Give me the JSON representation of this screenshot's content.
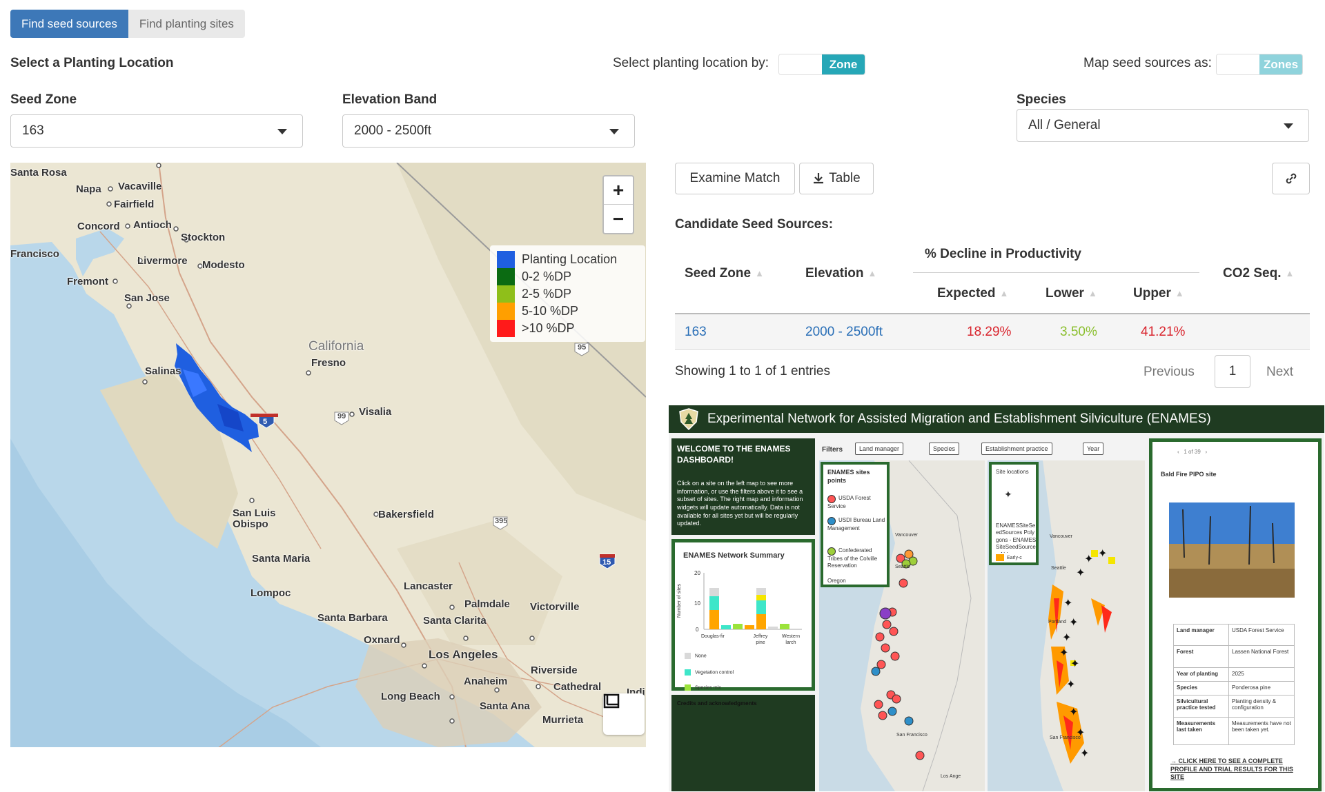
{
  "tabs": {
    "active": "Find seed sources",
    "inactive": "Find planting sites"
  },
  "header": {
    "select_title": "Select a Planting Location",
    "select_by_label": "Select planting location by:",
    "select_by_value": "Zone",
    "map_as_label": "Map seed sources as:",
    "map_as_value": "Zones"
  },
  "filters": {
    "seed_zone_label": "Seed Zone",
    "seed_zone_value": "163",
    "elevation_label": "Elevation Band",
    "elevation_value": "2000 - 2500ft",
    "species_label": "Species",
    "species_value": "All / General"
  },
  "map": {
    "zoom_in": "+",
    "zoom_out": "−",
    "labels": {
      "santa_rosa": "Santa Rosa",
      "napa": "Napa",
      "vacaville": "Vacaville",
      "fairfield": "Fairfield",
      "concord": "Concord",
      "antioch": "Antioch",
      "stockton": "Stockton",
      "san_francisco": "Francisco",
      "livermore": "Livermore",
      "modesto": "Modesto",
      "fremont": "Fremont",
      "san_jose": "San Jose",
      "california": "California",
      "fresno": "Fresno",
      "salinas": "Salinas",
      "visalia": "Visalia",
      "san_luis": "San Luis",
      "obispo": "Obispo",
      "bakersfield": "Bakersfield",
      "santa_maria": "Santa Maria",
      "lancaster": "Lancaster",
      "lompoc": "Lompoc",
      "palmdale": "Palmdale",
      "victorville": "Victorville",
      "santa_barbara": "Santa Barbara",
      "santa_clarita": "Santa Clarita",
      "oxnard": "Oxnard",
      "los_angeles": "Los Angeles",
      "riverside": "Riverside",
      "anaheim": "Anaheim",
      "cathedral": "Cathedral",
      "long_beach": "Long Beach",
      "santa_ana": "Santa Ana",
      "murrieta": "Murrieta",
      "indi": "Indi",
      "hwy95": "95",
      "hwy99": "99",
      "hwy5": "5",
      "hwy395": "395",
      "hwy15": "15"
    },
    "legend": [
      {
        "label": "Planting Location",
        "color": "#1f5fe0"
      },
      {
        "label": "0-2 %DP",
        "color": "#0b6b12"
      },
      {
        "label": "2-5 %DP",
        "color": "#8fbf1a"
      },
      {
        "label": "5-10 %DP",
        "color": "#ff9f00"
      },
      {
        "label": ">10 %DP",
        "color": "#ff1a1a"
      }
    ]
  },
  "actions": {
    "examine": "Examine Match",
    "table": "Table"
  },
  "table": {
    "title": "Candidate Seed Sources:",
    "group_header": "% Decline in Productivity",
    "headers": {
      "seed_zone": "Seed Zone",
      "elevation": "Elevation",
      "expected": "Expected",
      "lower": "Lower",
      "upper": "Upper",
      "co2": "CO2 Seq."
    },
    "rows": [
      {
        "seed_zone": "163",
        "elevation": "2000 - 2500ft",
        "expected": "18.29%",
        "lower": "3.50%",
        "upper": "41.21%"
      }
    ],
    "info": "Showing 1 to 1 of 1 entries",
    "previous": "Previous",
    "page": "1",
    "next": "Next"
  },
  "dashboard": {
    "title": "Experimental Network for Assisted Migration and Establishment Silviculture (ENAMES)",
    "welcome_title": "WELCOME TO THE ENAMES DASHBOARD!",
    "welcome_body": "Click on a site on the left map to see more information, or use the filters above it to see a subset of sites. The right map and information widgets will update automatically. Data is not available for all sites yet but will be regularly updated.",
    "summary_title": "ENAMES Network Summary",
    "summary_y_label": "Number of sites",
    "summary_ticks": [
      "20",
      "10",
      "0"
    ],
    "summary_categories": [
      "Douglas-fir",
      "Jeffrey pine",
      "Western larch"
    ],
    "summary_legend": [
      "None",
      "Vegetation control",
      "Species mix"
    ],
    "credits": "Credits and acknowledgments",
    "filters_label": "Filters",
    "filter_chips": [
      "Land manager",
      "Species",
      "Establishment practice",
      "Year"
    ],
    "left_map_legend_title": "ENAMES sites points",
    "left_map_legend": [
      "USDA Forest Service",
      "USDI Bureau Land Management",
      "Confederated Tribes of the Colville Reservation",
      "Oregon"
    ],
    "right_map_legend_title": "Site locations",
    "right_map_legend_body": "ENAMESSiteSeedSources Polygons - ENAMESSiteSeedSources ALL",
    "right_map_legend_item": "Early-c",
    "map_labels": {
      "vancouver": "Vancouver",
      "seattle": "Seattle",
      "san_francisco": "San Francisco",
      "los_angeles": "Los Ange",
      "portland": "Portland"
    },
    "pager": "1 of 39",
    "site_title": "Bald Fire PIPO site",
    "site_info": [
      {
        "k": "Land manager",
        "v": "USDA Forest Service"
      },
      {
        "k": "Forest",
        "v": "Lassen National Forest"
      },
      {
        "k": "Year of planting",
        "v": "2025"
      },
      {
        "k": "Species",
        "v": "Ponderosa pine"
      },
      {
        "k": "Silvicultural practice tested",
        "v": "Planting density & configuration"
      },
      {
        "k": "Measurements last taken",
        "v": "Measurements have not been taken yet."
      }
    ],
    "site_link": "CLICK HERE TO SEE A COMPLETE PROFILE AND TRIAL RESULTS FOR THIS SITE"
  }
}
